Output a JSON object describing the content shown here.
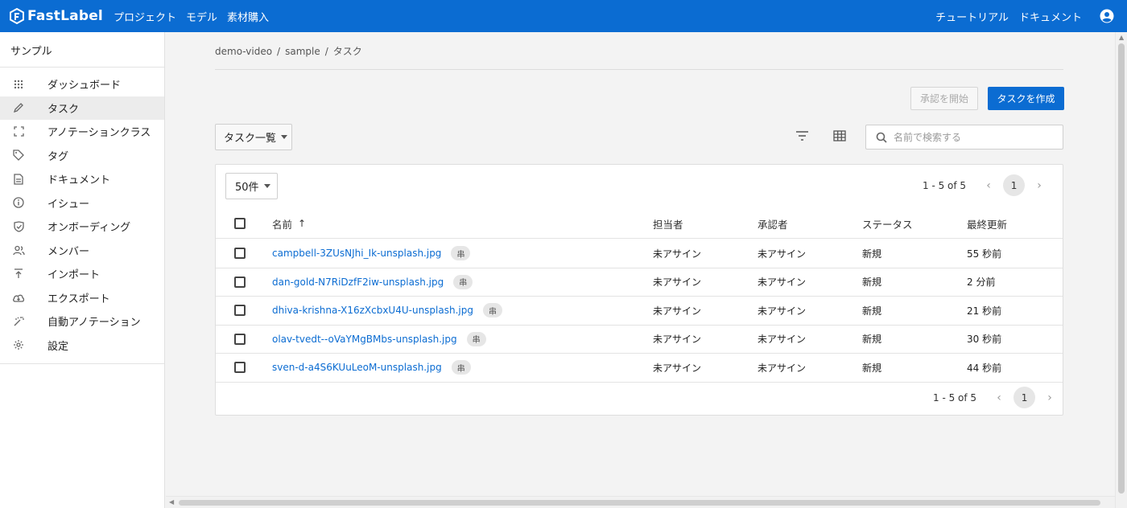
{
  "header": {
    "brand": "FastLabel",
    "nav": [
      "プロジェクト",
      "モデル",
      "素材購入"
    ],
    "right_links": [
      "チュートリアル",
      "ドキュメント"
    ]
  },
  "sidebar": {
    "project": "サンプル",
    "items": [
      {
        "label": "ダッシュボード",
        "icon": "dashboard-icon"
      },
      {
        "label": "タスク",
        "icon": "pencil-icon",
        "active": true
      },
      {
        "label": "アノテーションクラス",
        "icon": "crop-frame-icon"
      },
      {
        "label": "タグ",
        "icon": "tag-icon"
      },
      {
        "label": "ドキュメント",
        "icon": "document-icon"
      },
      {
        "label": "イシュー",
        "icon": "info-icon"
      },
      {
        "label": "オンボーディング",
        "icon": "shield-check-icon"
      },
      {
        "label": "メンバー",
        "icon": "members-icon"
      },
      {
        "label": "インポート",
        "icon": "upload-icon"
      },
      {
        "label": "エクスポート",
        "icon": "cloud-download-icon"
      },
      {
        "label": "自動アノテーション",
        "icon": "magic-wand-icon"
      },
      {
        "label": "設定",
        "icon": "gear-icon"
      }
    ]
  },
  "breadcrumb": [
    "demo-video",
    "sample",
    "タスク"
  ],
  "actions": {
    "approve": "承認を開始",
    "create": "タスクを作成"
  },
  "toolbar": {
    "view_select": "タスク一覧",
    "search_placeholder": "名前で検索する"
  },
  "table": {
    "per_page": "50件",
    "range": "1 - 5 of 5",
    "page": "1",
    "headers": {
      "name": "名前",
      "sort": "↑",
      "assignee": "担当者",
      "approver": "承認者",
      "status": "ステータス",
      "updated": "最終更新"
    },
    "rows": [
      {
        "name": "campbell-3ZUsNJhi_Ik-unsplash.jpg",
        "tag": "串",
        "assignee": "未アサイン",
        "approver": "未アサイン",
        "status": "新規",
        "updated": "55 秒前"
      },
      {
        "name": "dan-gold-N7RiDzfF2iw-unsplash.jpg",
        "tag": "串",
        "assignee": "未アサイン",
        "approver": "未アサイン",
        "status": "新規",
        "updated": "2 分前"
      },
      {
        "name": "dhiva-krishna-X16zXcbxU4U-unsplash.jpg",
        "tag": "串",
        "assignee": "未アサイン",
        "approver": "未アサイン",
        "status": "新規",
        "updated": "21 秒前"
      },
      {
        "name": "olav-tvedt--oVaYMgBMbs-unsplash.jpg",
        "tag": "串",
        "assignee": "未アサイン",
        "approver": "未アサイン",
        "status": "新規",
        "updated": "30 秒前"
      },
      {
        "name": "sven-d-a4S6KUuLeoM-unsplash.jpg",
        "tag": "串",
        "assignee": "未アサイン",
        "approver": "未アサイン",
        "status": "新規",
        "updated": "44 秒前"
      }
    ]
  },
  "colors": {
    "brand": "#0b6cd2",
    "link": "#0b6cd2"
  }
}
